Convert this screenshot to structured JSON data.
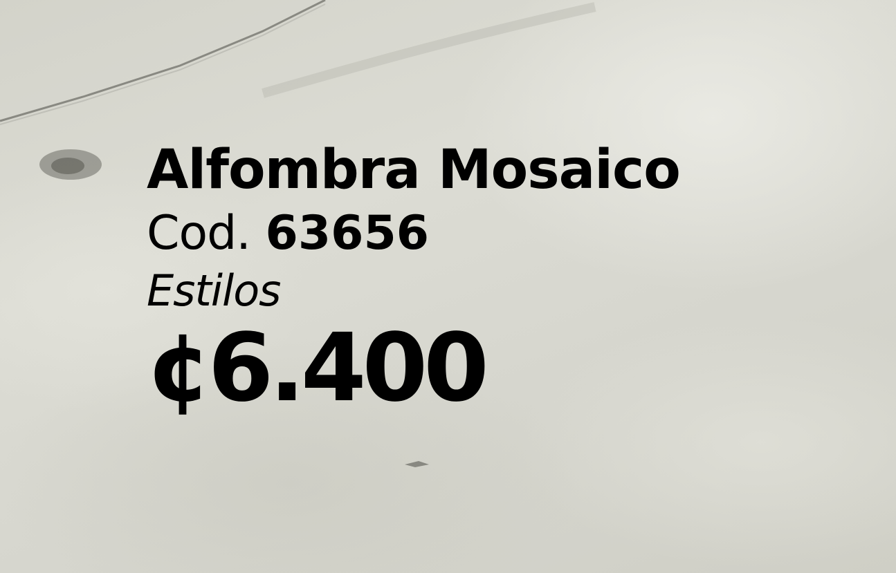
{
  "product": {
    "name": "Alfombra Mosaico",
    "code_label": "Cod.",
    "code_value": "63656",
    "brand": "Estilos",
    "price": "¢6.400"
  },
  "colors": {
    "text": "#000000",
    "background": "#d9d9d1"
  }
}
